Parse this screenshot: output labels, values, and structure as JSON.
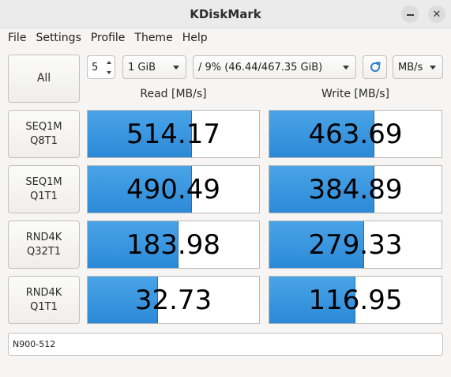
{
  "window": {
    "title": "KDiskMark"
  },
  "menu": [
    "File",
    "Settings",
    "Profile",
    "Theme",
    "Help"
  ],
  "controls": {
    "all_label": "All",
    "runs": "5",
    "size": "1 GiB",
    "target": "/ 9% (46.44/467.35 GiB)",
    "unit": "MB/s"
  },
  "columns": {
    "read": "Read [MB/s]",
    "write": "Write [MB/s]"
  },
  "tests": [
    {
      "line1": "SEQ1M",
      "line2": "Q8T1",
      "read": "514.17",
      "write": "463.69",
      "read_fill": 0.61,
      "write_fill": 0.61
    },
    {
      "line1": "SEQ1M",
      "line2": "Q1T1",
      "read": "490.49",
      "write": "384.89",
      "read_fill": 0.61,
      "write_fill": 0.61
    },
    {
      "line1": "RND4K",
      "line2": "Q32T1",
      "read": "183.98",
      "write": "279.33",
      "read_fill": 0.53,
      "write_fill": 0.55
    },
    {
      "line1": "RND4K",
      "line2": "Q1T1",
      "read": "32.73",
      "write": "116.95",
      "read_fill": 0.41,
      "write_fill": 0.5
    }
  ],
  "comment": "N900-512",
  "colors": {
    "bar": "#2c89d6",
    "accent": "#2a7fcf"
  }
}
